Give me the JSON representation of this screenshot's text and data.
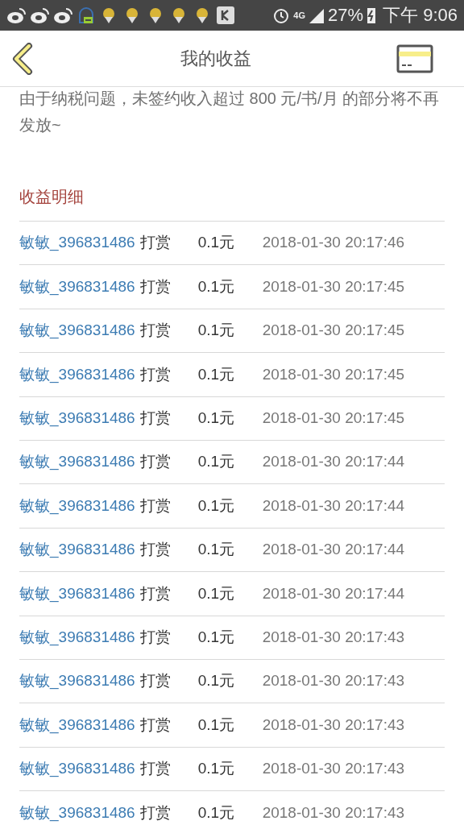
{
  "status_bar": {
    "network": "4G",
    "battery": "27%",
    "time": "下午 9:06"
  },
  "header": {
    "title": "我的收益"
  },
  "notice": "由于纳税问题，未签约收入超过 800 元/书/月 的部分将不再发放~",
  "section_title": "收益明细",
  "rows": [
    {
      "user": "敏敏_396831486",
      "action": "打赏",
      "amount": "0.1元",
      "time": "2018-01-30 20:17:46"
    },
    {
      "user": "敏敏_396831486",
      "action": "打赏",
      "amount": "0.1元",
      "time": "2018-01-30 20:17:45"
    },
    {
      "user": "敏敏_396831486",
      "action": "打赏",
      "amount": "0.1元",
      "time": "2018-01-30 20:17:45"
    },
    {
      "user": "敏敏_396831486",
      "action": "打赏",
      "amount": "0.1元",
      "time": "2018-01-30 20:17:45"
    },
    {
      "user": "敏敏_396831486",
      "action": "打赏",
      "amount": "0.1元",
      "time": "2018-01-30 20:17:45"
    },
    {
      "user": "敏敏_396831486",
      "action": "打赏",
      "amount": "0.1元",
      "time": "2018-01-30 20:17:44"
    },
    {
      "user": "敏敏_396831486",
      "action": "打赏",
      "amount": "0.1元",
      "time": "2018-01-30 20:17:44"
    },
    {
      "user": "敏敏_396831486",
      "action": "打赏",
      "amount": "0.1元",
      "time": "2018-01-30 20:17:44"
    },
    {
      "user": "敏敏_396831486",
      "action": "打赏",
      "amount": "0.1元",
      "time": "2018-01-30 20:17:44"
    },
    {
      "user": "敏敏_396831486",
      "action": "打赏",
      "amount": "0.1元",
      "time": "2018-01-30 20:17:43"
    },
    {
      "user": "敏敏_396831486",
      "action": "打赏",
      "amount": "0.1元",
      "time": "2018-01-30 20:17:43"
    },
    {
      "user": "敏敏_396831486",
      "action": "打赏",
      "amount": "0.1元",
      "time": "2018-01-30 20:17:43"
    },
    {
      "user": "敏敏_396831486",
      "action": "打赏",
      "amount": "0.1元",
      "time": "2018-01-30 20:17:43"
    },
    {
      "user": "敏敏_396831486",
      "action": "打赏",
      "amount": "0.1元",
      "time": "2018-01-30 20:17:43"
    }
  ]
}
